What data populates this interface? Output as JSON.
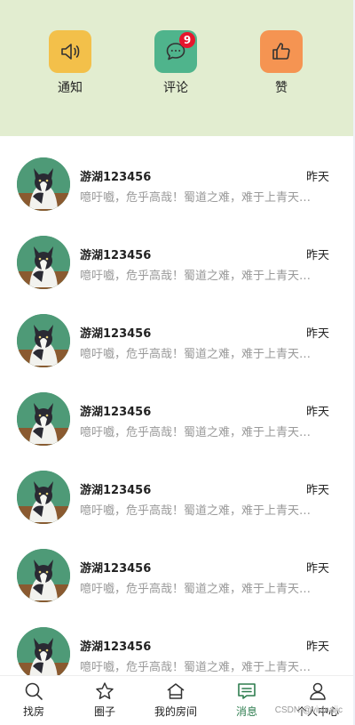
{
  "header": {
    "items": [
      {
        "label": "通知",
        "icon": "speaker-icon",
        "color": "#f3c04a"
      },
      {
        "label": "评论",
        "icon": "chat-icon",
        "color": "#4fb48c",
        "badge": "9"
      },
      {
        "label": "赞",
        "icon": "thumbs-up-icon",
        "color": "#f59452"
      }
    ]
  },
  "messages": [
    {
      "name": "游湖123456",
      "time": "昨天",
      "text": "噫吁嚱，危乎高哉！蜀道之难，难于上青天！蚕丛及鱼凫，开国何茫然"
    },
    {
      "name": "游湖123456",
      "time": "昨天",
      "text": "噫吁嚱，危乎高哉！蜀道之难，难于上青天！蚕丛及鱼凫，开国何茫然"
    },
    {
      "name": "游湖123456",
      "time": "昨天",
      "text": "噫吁嚱，危乎高哉！蜀道之难，难于上青天！蚕丛及鱼凫，开国何茫然"
    },
    {
      "name": "游湖123456",
      "time": "昨天",
      "text": "噫吁嚱，危乎高哉！蜀道之难，难于上青天！蚕丛及鱼凫，开国何茫然"
    },
    {
      "name": "游湖123456",
      "time": "昨天",
      "text": "噫吁嚱，危乎高哉！蜀道之难，难于上青天！蚕丛及鱼凫，开国何茫然"
    },
    {
      "name": "游湖123456",
      "time": "昨天",
      "text": "噫吁嚱，危乎高哉！蜀道之难，难于上青天！蚕丛及鱼凫，开国何茫然"
    },
    {
      "name": "游湖123456",
      "time": "昨天",
      "text": "噫吁嚱，危乎高哉！蜀道之难，难于上青天！蚕丛及鱼凫，开国何茫然"
    }
  ],
  "tabbar": {
    "items": [
      {
        "label": "找房",
        "icon": "search-icon"
      },
      {
        "label": "圈子",
        "icon": "star-icon"
      },
      {
        "label": "我的房间",
        "icon": "home-icon"
      },
      {
        "label": "消息",
        "icon": "message-icon",
        "active": true
      },
      {
        "label": "个人中心",
        "icon": "user-icon"
      }
    ],
    "active_color": "#2e7d4f"
  },
  "watermark": "CSDN @vivinaiic"
}
